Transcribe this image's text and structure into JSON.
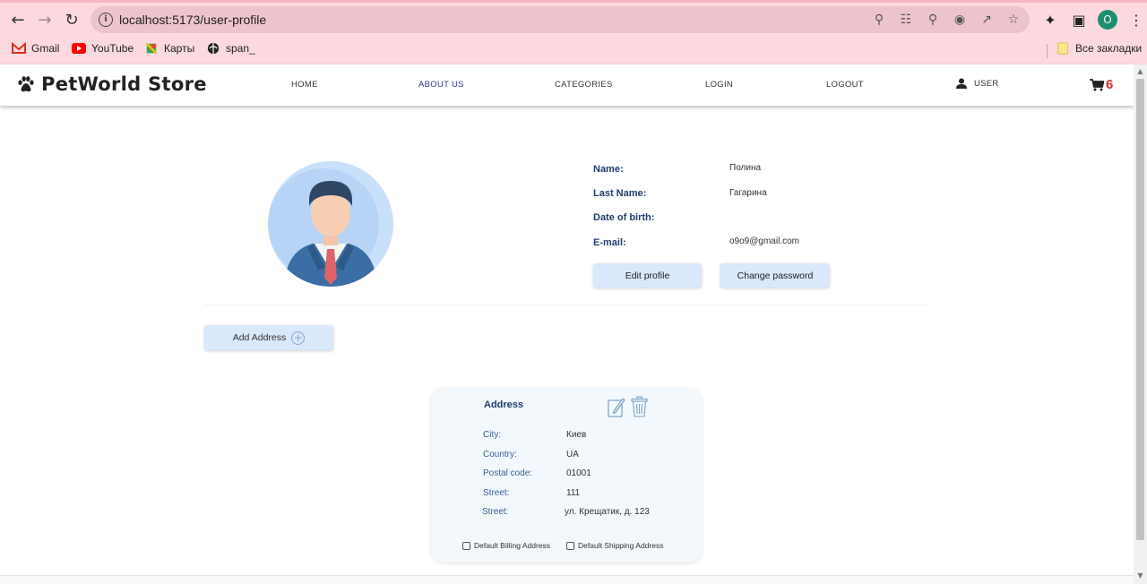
{
  "browser": {
    "url": "localhost:5173/user-profile",
    "profile_initial": "O",
    "bookmarks": [
      {
        "label": "Gmail",
        "icon": "gmail-icon"
      },
      {
        "label": "YouTube",
        "icon": "youtube-icon"
      },
      {
        "label": "Карты",
        "icon": "maps-icon"
      },
      {
        "label": "span_",
        "icon": "globe-icon"
      }
    ],
    "all_bookmarks_label": "Все закладки"
  },
  "header": {
    "logo_text": "PetWorld Store",
    "menu": [
      {
        "label": "HOME",
        "active": false
      },
      {
        "label": "ABOUT US",
        "active": true
      },
      {
        "label": "CATEGORIES",
        "active": false
      },
      {
        "label": "LOGIN",
        "active": false
      },
      {
        "label": "LOGOUT",
        "active": false
      }
    ],
    "user_label": "USER",
    "cart_count": "6"
  },
  "profile": {
    "fields": [
      {
        "label": "Name:",
        "value": "Полина"
      },
      {
        "label": "Last Name:",
        "value": "Гагарина"
      },
      {
        "label": "Date of birth:",
        "value": ""
      },
      {
        "label": "E-mail:",
        "value": "o9o9@gmail.com"
      }
    ],
    "edit_button": "Edit profile",
    "change_password_button": "Change password",
    "add_address_button": "Add Address"
  },
  "address": {
    "title": "Address",
    "rows": [
      {
        "label": "City:",
        "value": "Киев"
      },
      {
        "label": "Country:",
        "value": "UA"
      },
      {
        "label": "Postal code:",
        "value": "01001"
      },
      {
        "label": "Street:",
        "value": "111"
      },
      {
        "label": "Street:",
        "value": "ул. Крещатик, д. 123"
      }
    ],
    "default_billing_label": "Default Billing Address",
    "default_shipping_label": "Default Shipping Address"
  },
  "colors": {
    "chrome_bg": "#fbd9df",
    "button_bg": "#d9e8fb",
    "label_navy": "#1f3d6e",
    "cart_red": "#d32f2f",
    "active_menu": "#2b3a8f"
  }
}
